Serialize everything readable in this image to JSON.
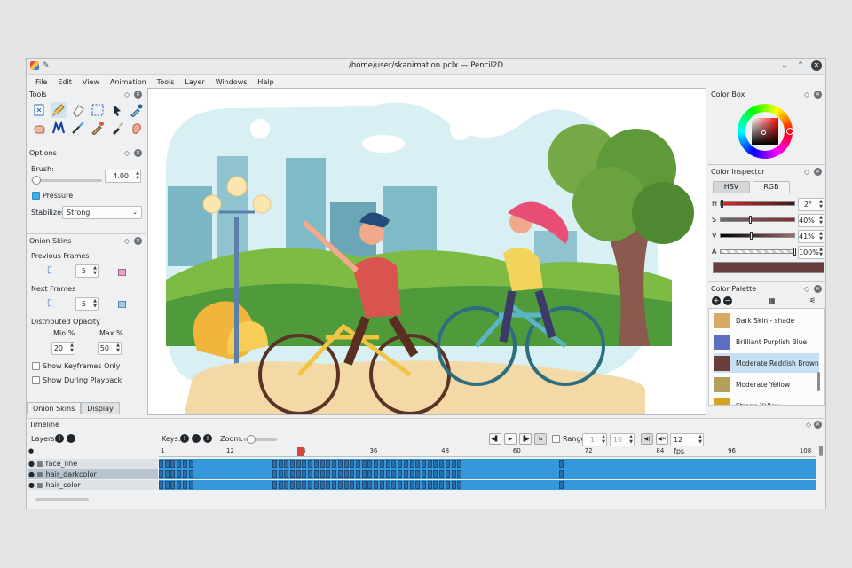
{
  "window": {
    "title": "/home/user/skanimation.pclx — Pencil2D"
  },
  "menu": [
    "File",
    "Edit",
    "View",
    "Animation",
    "Tools",
    "Layer",
    "Windows",
    "Help"
  ],
  "tools_panel": {
    "title": "Tools"
  },
  "options_panel": {
    "title": "Options",
    "brush_label": "Brush:",
    "brush_value": "4.00",
    "brush_fraction": 0.08,
    "pressure_label": "Pressure",
    "pressure_checked": true,
    "stabilizer_label": "Stabilizer",
    "stabilizer_value": "Strong"
  },
  "onion_panel": {
    "title": "Onion Skins",
    "previous_label": "Previous Frames",
    "previous_value": "5",
    "next_label": "Next Frames",
    "next_value": "5",
    "opacity_label": "Distributed Opacity",
    "min_label": "Min.%",
    "max_label": "Max.%",
    "min_value": "20",
    "max_value": "50",
    "keyframes_only_label": "Show Keyframes Only",
    "during_playback_label": "Show During Playback",
    "tabs": [
      "Onion Skins",
      "Display"
    ]
  },
  "color_box": {
    "title": "Color Box"
  },
  "color_inspector": {
    "title": "Color Inspector",
    "modes": [
      "HSV",
      "RGB"
    ],
    "active_mode": "HSV",
    "channels": [
      {
        "label": "H",
        "value": "2°",
        "fraction": 0.01
      },
      {
        "label": "S",
        "value": "40%",
        "fraction": 0.4
      },
      {
        "label": "V",
        "value": "41%",
        "fraction": 0.41
      },
      {
        "label": "A",
        "value": "100%",
        "fraction": 1.0
      }
    ],
    "current_color": "#693f3e"
  },
  "color_palette": {
    "title": "Color Palette",
    "items": [
      {
        "name": "Dark Skin - shade",
        "color": "#d8a865"
      },
      {
        "name": "Brilliant Purplish Blue",
        "color": "#5a6fbf"
      },
      {
        "name": "Moderate Reddish Brown",
        "color": "#6b3e3a",
        "selected": true
      },
      {
        "name": "Moderate Yellow",
        "color": "#b5a05b"
      },
      {
        "name": "Strong Yellow",
        "color": "#d3a41c"
      }
    ]
  },
  "timeline": {
    "title": "Timeline",
    "layers_label": "Layers:",
    "keys_label": "Keys:",
    "zoom_label": "Zoom:",
    "range_label": "Range",
    "range_from": "1",
    "range_to": "10",
    "fps": "12 fps",
    "ruler_ticks": [
      "1",
      "12",
      "24",
      "36",
      "48",
      "60",
      "72",
      "84",
      "96",
      "108"
    ],
    "current_frame": "24",
    "layers": [
      {
        "name": "face_line"
      },
      {
        "name": "hair_darkcolor"
      },
      {
        "name": "hair_color"
      }
    ]
  }
}
